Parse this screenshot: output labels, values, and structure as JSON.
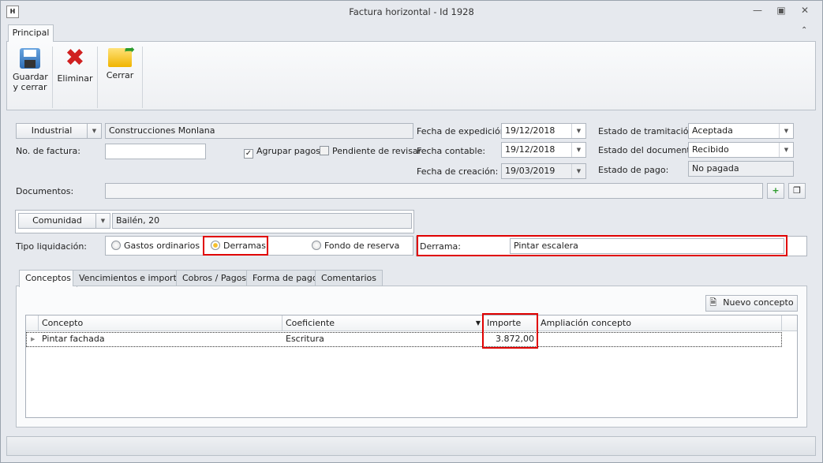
{
  "window": {
    "title": "Factura horizontal - Id 1928"
  },
  "ribbon": {
    "tab": "Principal",
    "buttons": [
      {
        "label": "Guardar y cerrar",
        "icon": "floppy-disk-icon"
      },
      {
        "label": "Eliminar",
        "icon": "red-x-icon"
      },
      {
        "label": "Cerrar",
        "icon": "open-folder-icon"
      }
    ]
  },
  "form": {
    "provider_type": "Industrial",
    "provider_name": "Construcciones Monlana",
    "invoice_no_label": "No. de factura:",
    "invoice_no": "",
    "agrupar_pagos": "Agrupar pagos",
    "agrupar_checked": true,
    "pendiente": "Pendiente de revisar",
    "pendiente_checked": false,
    "fecha_expedicion_label": "Fecha de expedición:",
    "fecha_expedicion": "19/12/2018",
    "fecha_contable_label": "Fecha contable:",
    "fecha_contable": "19/12/2018",
    "fecha_creacion_label": "Fecha de creación:",
    "fecha_creacion": "19/03/2019",
    "estado_tramitacion_label": "Estado de tramitación:",
    "estado_tramitacion": "Aceptada",
    "estado_documento_label": "Estado del documento:",
    "estado_documento": "Recibido",
    "estado_pago_label": "Estado de pago:",
    "estado_pago": "No pagada",
    "documentos_label": "Documentos:",
    "comunidad_btn": "Comunidad",
    "comunidad": "Bailén, 20",
    "tipo_label": "Tipo liquidación:",
    "tipo_options": [
      "Gastos ordinarios",
      "Derramas",
      "Fondo de reserva"
    ],
    "tipo_selected": "Derramas",
    "derrama_label": "Derrama:",
    "derrama": "Pintar escalera"
  },
  "tabs": [
    "Conceptos",
    "Vencimientos e importes",
    "Cobros / Pagos",
    "Forma de pago",
    "Comentarios"
  ],
  "grid": {
    "new_button": "Nuevo concepto",
    "columns": [
      "Concepto",
      "Coeficiente",
      "Importe",
      "Ampliación concepto"
    ],
    "rows": [
      {
        "concepto": "Pintar fachada",
        "coeficiente": "Escritura",
        "importe": "3.872,00",
        "ampliacion": ""
      }
    ]
  }
}
